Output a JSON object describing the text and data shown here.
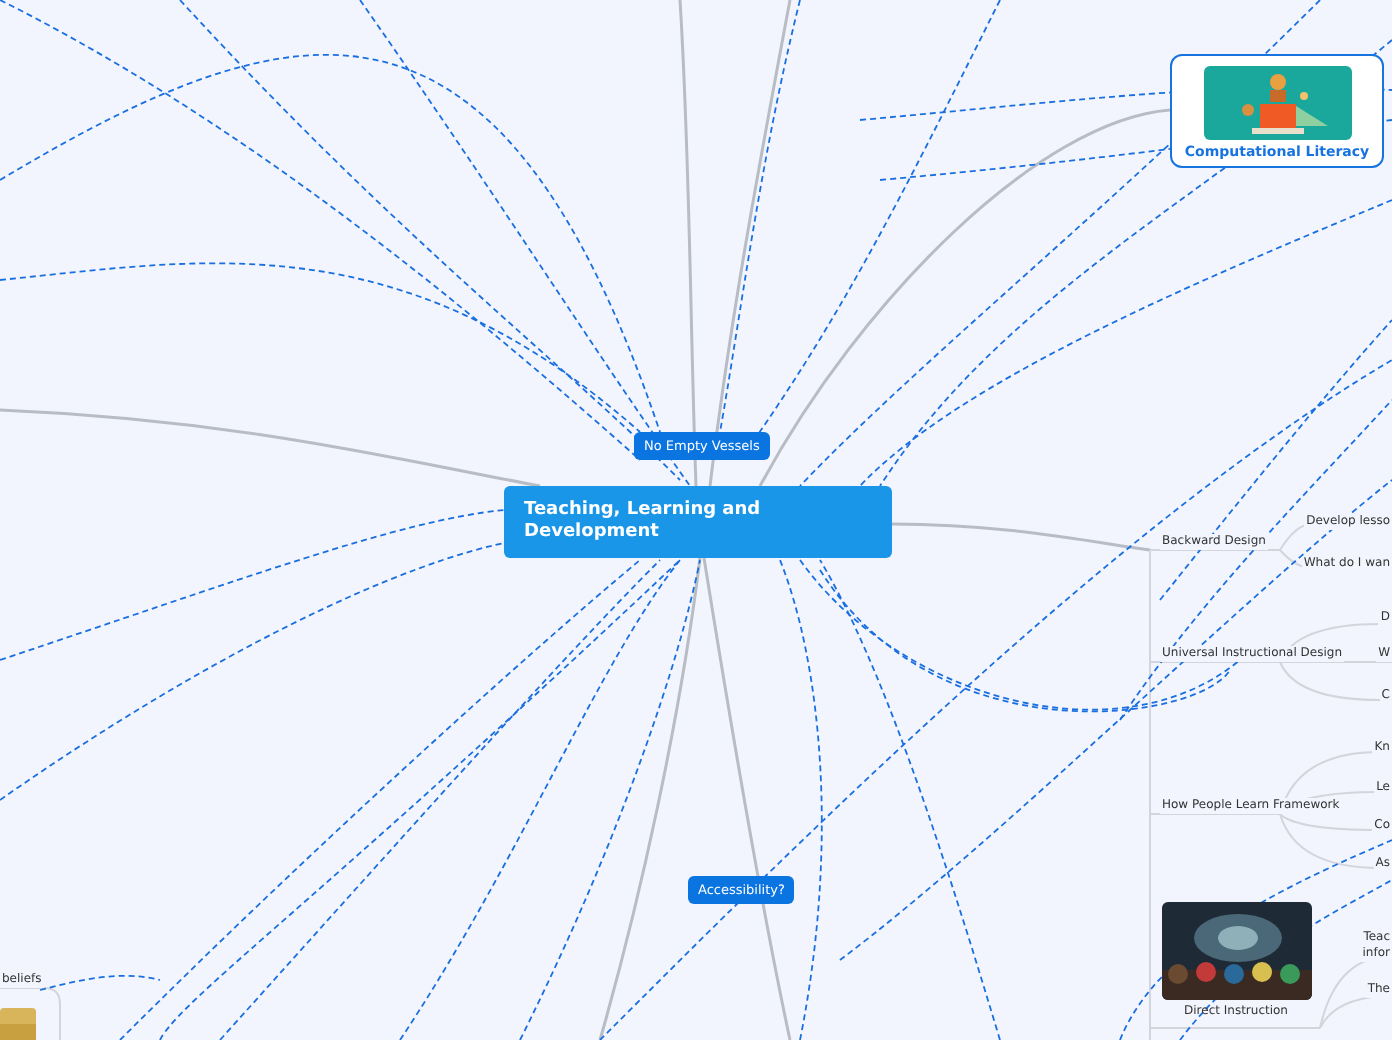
{
  "central": {
    "text": "Teaching, Learning and Development"
  },
  "floating": [
    {
      "text": "No Empty Vessels"
    },
    {
      "text": "Accessibility?"
    }
  ],
  "topics": [
    {
      "kind": "picture-topic",
      "text": "Computational Literacy"
    },
    {
      "kind": "plain",
      "text": "Backward Design"
    },
    {
      "kind": "plain",
      "text": "Universal Instructional Design"
    },
    {
      "kind": "plain",
      "text": "How People Learn Framework"
    },
    {
      "kind": "picture-topic",
      "text": "Direct Instruction"
    },
    {
      "kind": "plain",
      "text": "beliefs"
    }
  ],
  "leaves": [
    {
      "text": "Develop lesso"
    },
    {
      "text": "What do I wan"
    },
    {
      "text": "D"
    },
    {
      "text": "W"
    },
    {
      "text": "C"
    },
    {
      "text": "Kn"
    },
    {
      "text": "Le"
    },
    {
      "text": "Co"
    },
    {
      "text": "As"
    },
    {
      "text": "Teac"
    },
    {
      "text": "infor"
    },
    {
      "text": "The"
    }
  ]
}
